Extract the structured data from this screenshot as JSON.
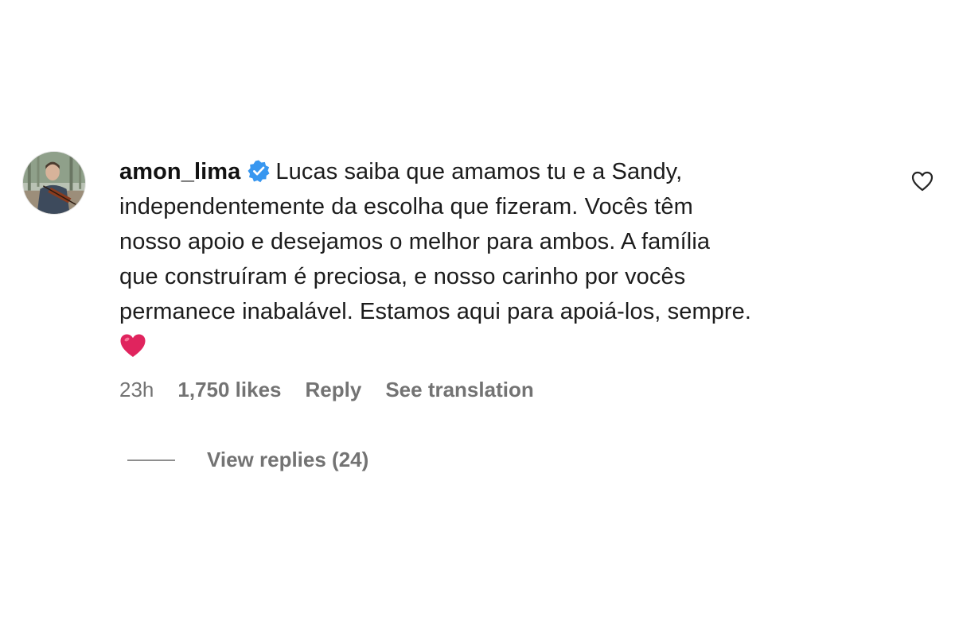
{
  "comment": {
    "username": "amon_lima",
    "verified": true,
    "text_line1": "Lucas saiba que amamos tu e a Sandy,",
    "text_line2": "independentemente da escolha que fizeram. Vocês têm",
    "text_line3": "nosso apoio e desejamos o melhor para ambos. A família",
    "text_line4": "que construíram é preciosa, e nosso carinho por vocês",
    "text_line5": "permanece inabalável. Estamos aqui para apoiá-los, sempre.",
    "emoji": "red-heart",
    "time": "23h",
    "likes": "1,750 likes",
    "reply_label": "Reply",
    "translate_label": "See translation",
    "view_replies_label": "View replies (24)",
    "like_icon": "heart-outline-icon"
  },
  "colors": {
    "text": "#1c1c1c",
    "muted": "#737373",
    "verified_badge": "#3897f0",
    "heart": "#e0245e"
  }
}
